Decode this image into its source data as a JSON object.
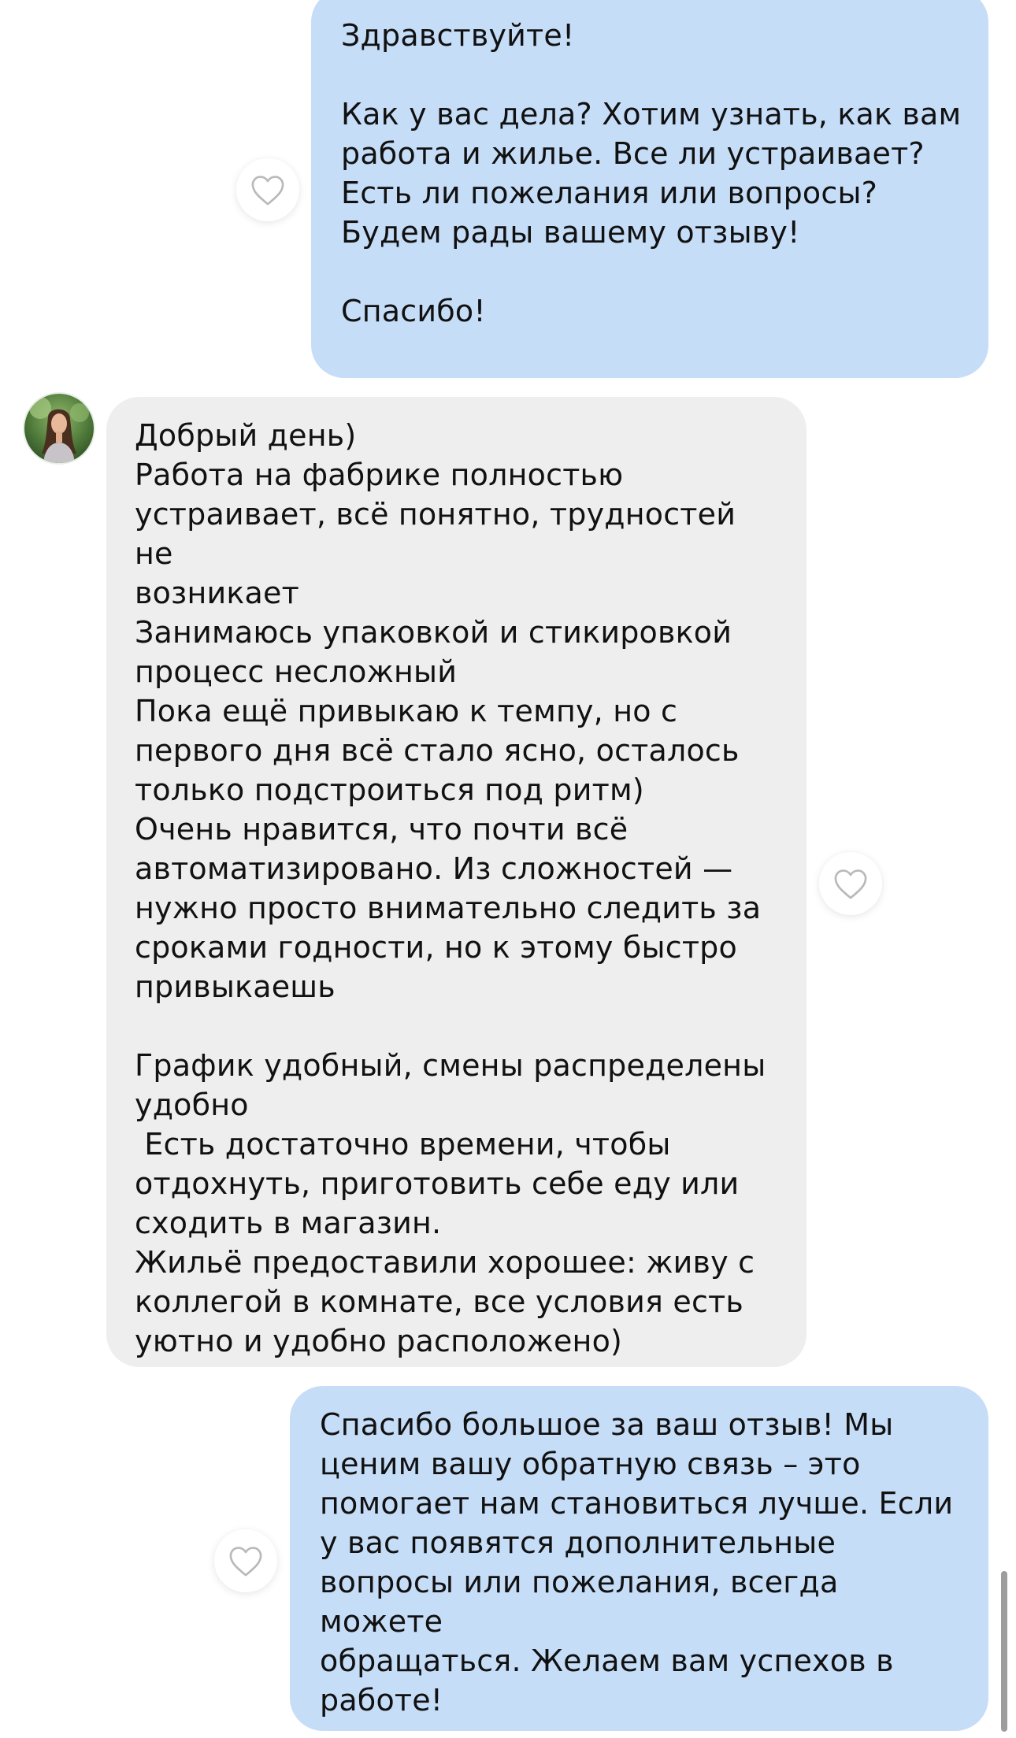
{
  "messages": [
    {
      "direction": "outgoing",
      "text": "Здравствуйте!\n\nКак у вас дела? Хотим узнать, как вам\nработа и жилье. Все ли устраивает?\nЕсть ли пожелания или вопросы?\nБудем рады вашему отзыву!\n\nСпасибо!"
    },
    {
      "direction": "incoming",
      "text": "Добрый день)\nРабота на фабрике полностью\nустраивает, всё понятно, трудностей не\nвозникает\nЗанимаюсь упаковкой и стикировкой\nпроцесс несложный\nПока ещё привыкаю к темпу, но с\nпервого дня всё стало ясно, осталось\nтолько подстроиться под ритм)\nОчень нравится, что почти всё\nавтоматизировано. Из сложностей —\nнужно просто внимательно следить за\nсроками годности, но к этому быстро\nпривыкаешь\n\nГрафик удобный, смены распределены\nудобно\n Есть достаточно времени, чтобы\nотдохнуть, приготовить себе еду или\nсходить в магазин.\nЖильё предоставили хорошее: живу с\nколлегой в комнате, все условия есть\nуютно и удобно расположено)"
    },
    {
      "direction": "outgoing",
      "text": "Спасибо большое за ваш отзыв! Мы\nценим вашу обратную связь – это\nпомогает нам становиться лучше. Если\nу вас появятся дополнительные\nвопросы или пожелания, всегда можете\nобращаться. Желаем вам успехов в\nработе!"
    }
  ],
  "icons": {
    "reaction": "heart-outline-icon",
    "sender": "avatar"
  },
  "colors": {
    "outgoing_bubble": "#c6ddf8",
    "incoming_bubble": "#eeeeee",
    "text": "#111111",
    "heart_stroke": "#b9b9b9"
  }
}
